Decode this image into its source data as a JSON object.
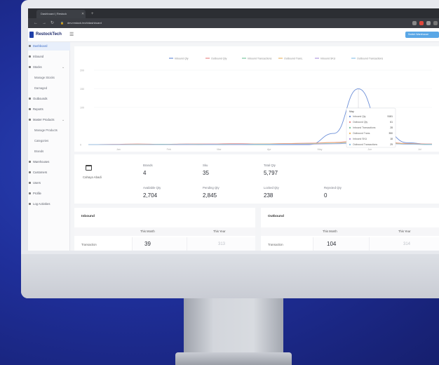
{
  "browser": {
    "tab_title": "Dashboard | Restock",
    "url": "dev.restock.tech/dashboard"
  },
  "app": {
    "logo_text": "RestockTech",
    "header_button": "Switch Warehouse"
  },
  "sidebar": {
    "items": [
      {
        "label": "Dashboard",
        "active": true
      },
      {
        "label": "Inbound"
      },
      {
        "label": "Stocks",
        "chevron": true
      },
      {
        "label": "Manage Stocks",
        "sub": true
      },
      {
        "label": "Damaged",
        "sub": true
      },
      {
        "label": "Outbounds"
      },
      {
        "label": "Reports"
      },
      {
        "label": "Master Products",
        "chevron": true
      },
      {
        "label": "Manage Products",
        "sub": true
      },
      {
        "label": "Categories",
        "sub": true
      },
      {
        "label": "Brands",
        "sub": true
      },
      {
        "label": "Warehouses"
      },
      {
        "label": "Customers"
      },
      {
        "label": "Users"
      },
      {
        "label": "Profile"
      },
      {
        "label": "Log Activities"
      }
    ]
  },
  "chart_data": {
    "type": "line",
    "legend": [
      "Inbound Qty",
      "Outbound Qty",
      "Inbound Transactions",
      "Outbound Trans.",
      "Inbound SKU",
      "Outbound Transactions"
    ],
    "legend_placement": "top",
    "y_ticks": [
      "200",
      "150",
      "100",
      "0"
    ],
    "ylim": [
      0,
      200
    ],
    "x": [
      0,
      1,
      2,
      3,
      4,
      5,
      6,
      7,
      8,
      9,
      10,
      11,
      12,
      13,
      14
    ],
    "x_ticks": [
      "Jan",
      "Feb",
      "Mar",
      "Apr",
      "May",
      "Jun",
      "Jul"
    ],
    "series": [
      {
        "name": "Inbound Qty",
        "color": "#6c8fd8",
        "values": [
          0,
          0,
          0,
          0,
          0,
          0,
          0,
          0,
          0,
          0,
          30,
          150,
          40,
          5,
          0
        ]
      },
      {
        "name": "Outbound Qty",
        "color": "#e88a8a",
        "values": [
          0,
          1,
          2,
          1,
          2,
          2,
          3,
          2,
          3,
          4,
          6,
          10,
          8,
          3,
          2
        ]
      },
      {
        "name": "Inbound Transactions",
        "color": "#7cc7a0",
        "values": [
          0,
          0,
          0,
          1,
          0,
          1,
          1,
          0,
          1,
          2,
          3,
          8,
          5,
          2,
          1
        ]
      },
      {
        "name": "Outbound Trans.",
        "color": "#e9b86a",
        "values": [
          0,
          0,
          1,
          0,
          1,
          1,
          1,
          2,
          2,
          3,
          5,
          7,
          6,
          2,
          0
        ]
      },
      {
        "name": "Inbound SKU",
        "color": "#b19be0",
        "values": [
          0,
          0,
          0,
          0,
          0,
          1,
          0,
          1,
          1,
          1,
          2,
          4,
          3,
          1,
          0
        ]
      },
      {
        "name": "Outbound Transactions",
        "color": "#8ec5e8",
        "values": [
          0,
          0,
          0,
          0,
          1,
          0,
          1,
          1,
          1,
          2,
          3,
          5,
          4,
          1,
          0
        ]
      }
    ],
    "tooltip": {
      "title": "May",
      "rows": [
        {
          "label": "Inbound Qty",
          "value": "5181"
        },
        {
          "label": "Outbound Qty",
          "value": "61"
        },
        {
          "label": "Inbound Transactions",
          "value": "28"
        },
        {
          "label": "Outbound Trans.",
          "value": "350"
        },
        {
          "label": "Inbound SKU",
          "value": "18"
        },
        {
          "label": "Outbound Transactions",
          "value": "29"
        }
      ]
    }
  },
  "stats": {
    "warehouse_name": "Cahaya Abadi",
    "items": [
      {
        "label": "Brands",
        "value": "4"
      },
      {
        "label": "Sku",
        "value": "35"
      },
      {
        "label": "Total Qty",
        "value": "5,797"
      },
      {
        "label": "Available Qty",
        "value": "2,704"
      },
      {
        "label": "Pending Qty",
        "value": "2,845"
      },
      {
        "label": "Locked Qty",
        "value": "238"
      },
      {
        "label": "Rejected Qty",
        "value": "0"
      }
    ]
  },
  "tables": [
    {
      "title": "Inbound",
      "col1": "This Month",
      "col2": "This Year",
      "row_label": "Transaction",
      "val1": "39",
      "val2": "313"
    },
    {
      "title": "Outbound",
      "col1": "This Month",
      "col2": "This Year",
      "row_label": "Transaction",
      "val1": "104",
      "val2": "314"
    }
  ]
}
